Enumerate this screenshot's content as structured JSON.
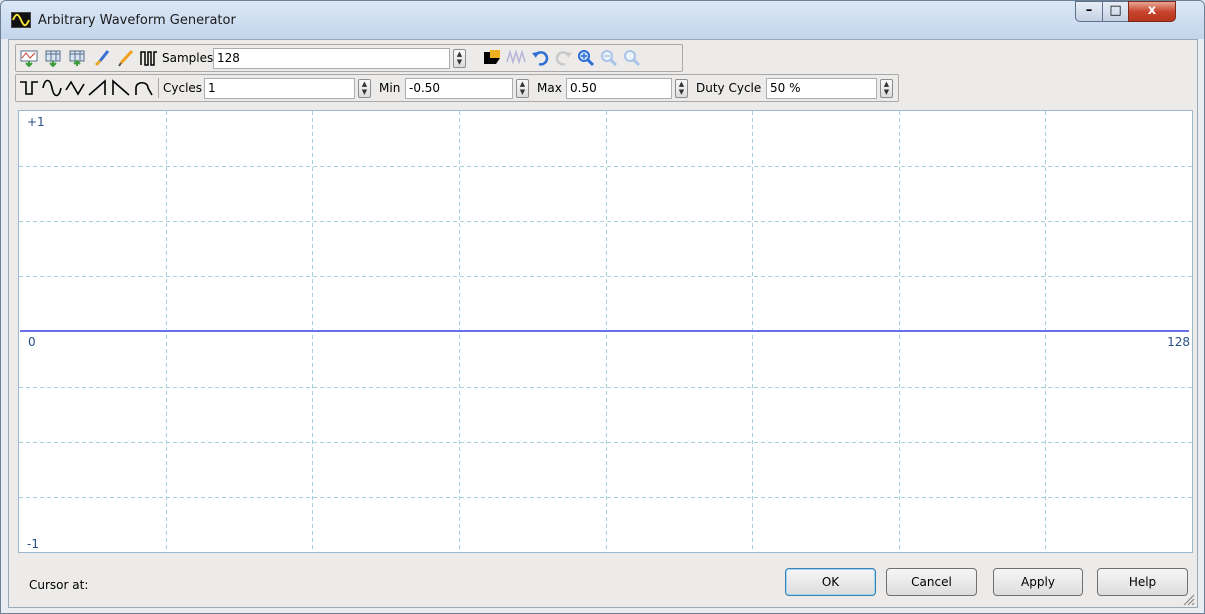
{
  "window": {
    "title": "Arbitrary Waveform Generator",
    "controls": {
      "minimize": "–",
      "maximize": "□",
      "close": "x"
    }
  },
  "toolbar1": {
    "icons": [
      "import-waveform-icon",
      "import-table-icon",
      "export-table-icon",
      "brush-icon",
      "pencil-icon",
      "samples-icon"
    ],
    "samples_label": "Samples",
    "samples_value": "128",
    "icons_right": [
      "fill-icon",
      "waveform-zoom-icon",
      "undo-icon",
      "redo-icon",
      "zoom-in-icon",
      "zoom-out-icon",
      "zoom-fit-icon"
    ]
  },
  "toolbar2": {
    "shape_icons": [
      "square-wave-icon",
      "sine-wave-icon",
      "triangle-wave-icon",
      "ramp-up-icon",
      "ramp-down-icon",
      "pulse-icon"
    ],
    "cycles_label": "Cycles",
    "cycles_value": "1",
    "min_label": "Min",
    "min_value": "-0.50",
    "max_label": "Max",
    "max_value": "0.50",
    "duty_label": "Duty Cycle",
    "duty_value": "50 %"
  },
  "plot": {
    "y_top_label": "+1",
    "y_mid_label": "0",
    "y_bottom_label": "-1",
    "x_end_label": "128",
    "grid_color": "#a6cfe0",
    "line_color": "#6b72e8",
    "border_color": "#9cb7cf"
  },
  "chart_data": {
    "type": "line",
    "x": [
      0,
      128
    ],
    "series": [
      {
        "values": [
          0,
          0
        ]
      }
    ],
    "xlim": [
      0,
      128
    ],
    "ylim": [
      -1,
      1
    ],
    "grid": true
  },
  "status": {
    "cursor_label": "Cursor at:"
  },
  "buttons": {
    "ok": "OK",
    "cancel": "Cancel",
    "apply": "Apply",
    "help": "Help"
  }
}
